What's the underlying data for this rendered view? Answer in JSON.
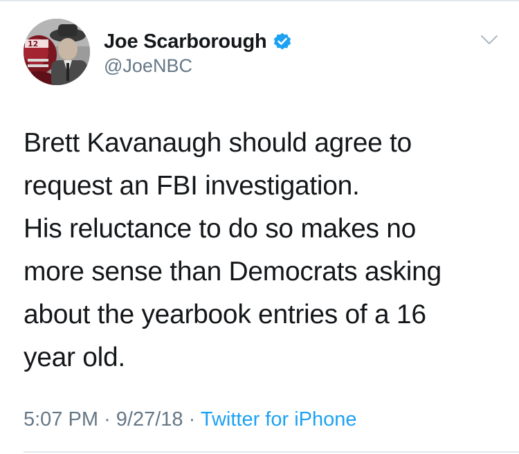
{
  "author": {
    "display_name": "Joe Scarborough",
    "handle": "@JoeNBC",
    "verified": true,
    "avatar_icon": "profile-photo",
    "verified_icon": "verified-badge-icon"
  },
  "tweet": {
    "text_lines": [
      "Brett Kavanaugh should agree to",
      "request an FBI investigation.",
      "His reluctance to do so makes no",
      "more sense than Democrats asking",
      "about the yearbook entries of a 16",
      "year old."
    ],
    "time": "5:07 PM",
    "separator": "·",
    "date": "9/27/18",
    "source": "Twitter for iPhone"
  },
  "menu": {
    "icon": "chevron-down-icon"
  },
  "colors": {
    "text": "#14171a",
    "secondary": "#657786",
    "link": "#1da1f2",
    "verified": "#1da1f2",
    "border": "#e1e8ed"
  }
}
